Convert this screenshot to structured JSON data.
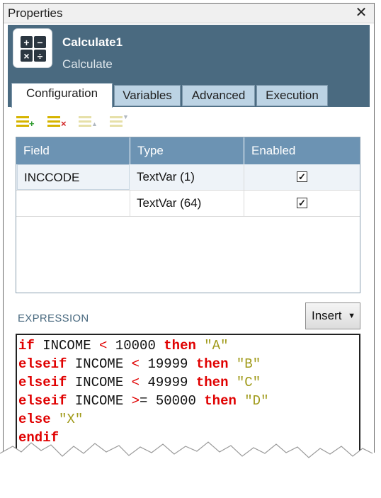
{
  "window": {
    "title": "Properties",
    "close_glyph": "✕"
  },
  "node": {
    "name": "Calculate1",
    "type": "Calculate",
    "icon": "calculator-icon",
    "icon_symbols": [
      "+",
      "−",
      "×",
      "÷"
    ]
  },
  "tabs": [
    {
      "label": "Configuration",
      "active": true
    },
    {
      "label": "Variables",
      "active": false
    },
    {
      "label": "Advanced",
      "active": false
    },
    {
      "label": "Execution",
      "active": false
    }
  ],
  "toolbar": [
    {
      "name": "add-row-icon",
      "enabled": true
    },
    {
      "name": "delete-row-icon",
      "enabled": true
    },
    {
      "name": "sort-ascending-icon",
      "enabled": false
    },
    {
      "name": "sort-descending-icon",
      "enabled": false
    }
  ],
  "table": {
    "columns": [
      "Field",
      "Type",
      "Enabled"
    ],
    "rows": [
      {
        "field": "INCCODE",
        "type": "TextVar (1)",
        "enabled": true
      },
      {
        "field": "",
        "type": "TextVar (64)",
        "enabled": true
      }
    ]
  },
  "expression": {
    "label": "EXPRESSION",
    "insert_label": "Insert",
    "insert_chevron": "▼",
    "lines": [
      [
        {
          "t": "if",
          "c": "kw"
        },
        {
          "t": " INCOME "
        },
        {
          "t": "<",
          "c": "op"
        },
        {
          "t": " 10000 "
        },
        {
          "t": "then",
          "c": "kw"
        },
        {
          "t": " "
        },
        {
          "t": "\"A\"",
          "c": "str"
        }
      ],
      [
        {
          "t": "elseif",
          "c": "kw"
        },
        {
          "t": " INCOME "
        },
        {
          "t": "<",
          "c": "op"
        },
        {
          "t": " 19999 "
        },
        {
          "t": "then",
          "c": "kw"
        },
        {
          "t": " "
        },
        {
          "t": "\"B\"",
          "c": "str"
        }
      ],
      [
        {
          "t": "elseif",
          "c": "kw"
        },
        {
          "t": " INCOME "
        },
        {
          "t": "<",
          "c": "op"
        },
        {
          "t": " 49999 "
        },
        {
          "t": "then",
          "c": "kw"
        },
        {
          "t": " "
        },
        {
          "t": "\"C\"",
          "c": "str"
        }
      ],
      [
        {
          "t": "elseif",
          "c": "kw"
        },
        {
          "t": " INCOME "
        },
        {
          "t": ">",
          "c": "op"
        },
        {
          "t": "= 50000 "
        },
        {
          "t": "then",
          "c": "kw"
        },
        {
          "t": " "
        },
        {
          "t": "\"D\"",
          "c": "str"
        }
      ],
      [
        {
          "t": "else",
          "c": "kw"
        },
        {
          "t": " "
        },
        {
          "t": "\"X\"",
          "c": "str"
        }
      ],
      [
        {
          "t": "endif",
          "c": "kw"
        }
      ]
    ]
  },
  "colors": {
    "header_bg": "#4a6a80",
    "table_header_bg": "#6c93b3",
    "tab_bg": "#bcd3e4",
    "keyword": "#e00000",
    "string": "#a09a1a"
  }
}
